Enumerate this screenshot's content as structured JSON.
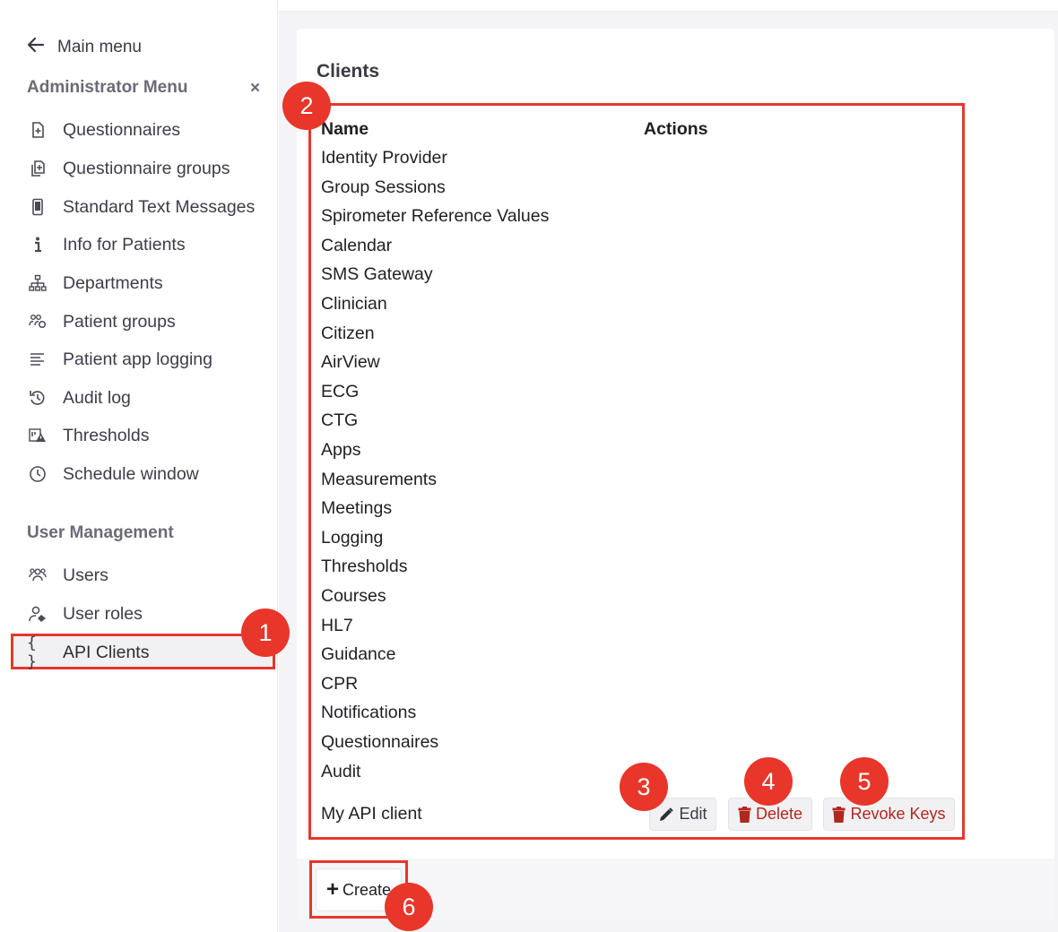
{
  "sidebar": {
    "main_menu": "Main menu",
    "admin_title": "Administrator Menu",
    "close": "×",
    "admin_items": [
      {
        "label": "Questionnaires",
        "icon": "file-plus-icon"
      },
      {
        "label": "Questionnaire groups",
        "icon": "files-icon"
      },
      {
        "label": "Standard Text Messages",
        "icon": "phone-icon"
      },
      {
        "label": "Info for Patients",
        "icon": "info-icon"
      },
      {
        "label": "Departments",
        "icon": "sitemap-icon"
      },
      {
        "label": "Patient groups",
        "icon": "patient-group-icon"
      },
      {
        "label": "Patient app logging",
        "icon": "list-icon"
      },
      {
        "label": "Audit log",
        "icon": "history-icon"
      },
      {
        "label": "Thresholds",
        "icon": "threshold-icon"
      },
      {
        "label": "Schedule window",
        "icon": "clock-icon"
      }
    ],
    "user_title": "User Management",
    "user_items": [
      {
        "label": "Users",
        "icon": "users-icon"
      },
      {
        "label": "User roles",
        "icon": "user-role-icon"
      }
    ],
    "api_clients": {
      "label": "API Clients",
      "icon_glyph": "{ }"
    }
  },
  "main": {
    "title": "Clients",
    "columns": [
      "Name",
      "Actions"
    ],
    "clients": [
      "Identity Provider",
      "Group Sessions",
      "Spirometer Reference Values",
      "Calendar",
      "SMS Gateway",
      "Clinician",
      "Citizen",
      "AirView",
      "ECG",
      "CTG",
      "Apps",
      "Measurements",
      "Meetings",
      "Logging",
      "Thresholds",
      "Courses",
      "HL7",
      "Guidance",
      "CPR",
      "Notifications",
      "Questionnaires",
      "Audit"
    ],
    "custom_client": "My API client",
    "actions": {
      "edit": "Edit",
      "delete": "Delete",
      "revoke": "Revoke Keys"
    },
    "create": "Create"
  },
  "badges": [
    "1",
    "2",
    "3",
    "4",
    "5",
    "6"
  ],
  "colors": {
    "accent_red": "#e8362a",
    "danger": "#b3261e"
  }
}
